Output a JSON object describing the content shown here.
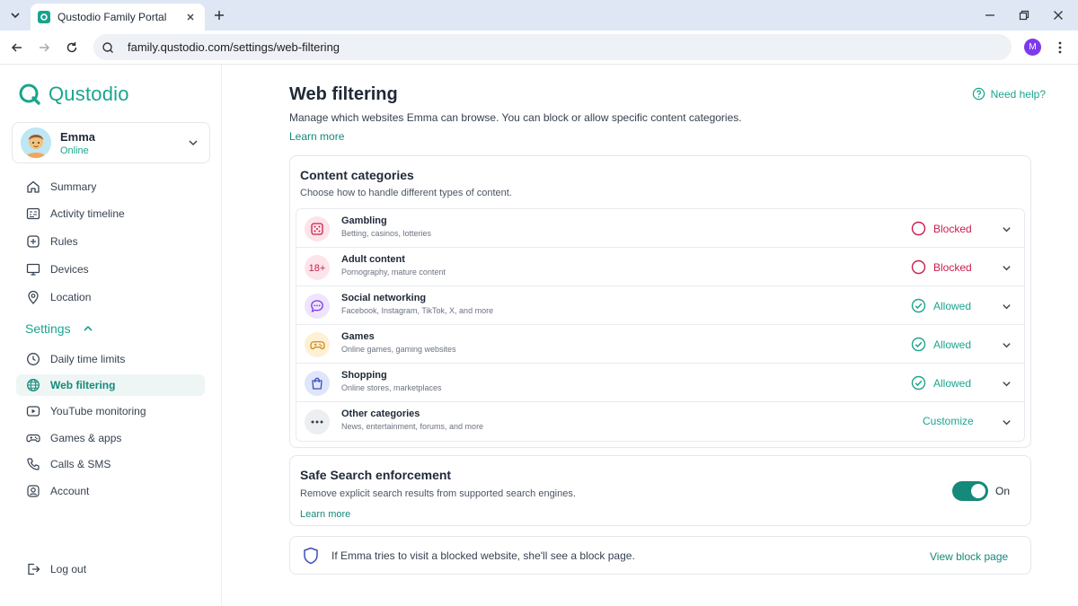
{
  "browser": {
    "tab_title": "Qustodio Family Portal",
    "url": "family.qustodio.com/settings/web-filtering",
    "profile_initial": "M"
  },
  "sidebar": {
    "logo_text": "Qustodio",
    "profile": {
      "name": "Emma",
      "status": "Online"
    },
    "nav": [
      {
        "label": "Summary",
        "icon": "home-icon"
      },
      {
        "label": "Activity timeline",
        "icon": "timeline-icon"
      },
      {
        "label": "Rules",
        "icon": "rules-icon"
      },
      {
        "label": "Devices",
        "icon": "monitor-icon"
      },
      {
        "label": "Location",
        "icon": "location-pin-icon"
      }
    ],
    "settings_label": "Settings",
    "settings_items": [
      {
        "label": "Daily time limits",
        "icon": "clock-icon",
        "active": false
      },
      {
        "label": "Web filtering",
        "icon": "globe-icon",
        "active": true
      },
      {
        "label": "YouTube monitoring",
        "icon": "youtube-icon",
        "active": false
      },
      {
        "label": "Games & apps",
        "icon": "gamepad-icon",
        "active": false
      },
      {
        "label": "Calls & SMS",
        "icon": "phone-icon",
        "active": false
      },
      {
        "label": "Account",
        "icon": "account-icon",
        "active": false
      }
    ],
    "logout_label": "Log out"
  },
  "main": {
    "title": "Web filtering",
    "description": "Manage which websites Emma can browse. You can block or allow specific content categories.",
    "learn_more": "Learn more",
    "need_help": "Need help?",
    "categories_card": {
      "title": "Content categories",
      "subtitle": "Choose how to handle different types of content.",
      "items": [
        {
          "name": "Gambling",
          "desc": "Betting, casinos, lotteries",
          "status": "Blocked",
          "icon": "dice-icon"
        },
        {
          "name": "Adult content",
          "desc": "Pornography, mature content",
          "status": "Blocked",
          "icon": "adult-18-icon"
        },
        {
          "name": "Social networking",
          "desc": "Facebook, Instagram, TikTok, X, and more",
          "status": "Allowed",
          "icon": "chat-bubble-icon"
        },
        {
          "name": "Games",
          "desc": "Online games, gaming websites",
          "status": "Allowed",
          "icon": "gamepad-icon"
        },
        {
          "name": "Shopping",
          "desc": "Online stores, marketplaces",
          "status": "Allowed",
          "icon": "shopping-bag-icon"
        },
        {
          "name": "Other categories",
          "desc": "News, entertainment, forums, and more",
          "action": "Customize",
          "icon": "more-dots-icon"
        }
      ]
    },
    "safe_search": {
      "title": "Safe Search enforcement",
      "desc": "Remove explicit search results from supported search engines.",
      "learn_more": "Learn more",
      "toggle_label": "On"
    },
    "block_notice": {
      "text": "If Emma tries to visit a blocked website, she'll see a block page.",
      "link": "View block page"
    }
  },
  "colors": {
    "brand": "#1aa58d",
    "brand_dark": "#15897a",
    "blocked": "#c81e4c"
  }
}
